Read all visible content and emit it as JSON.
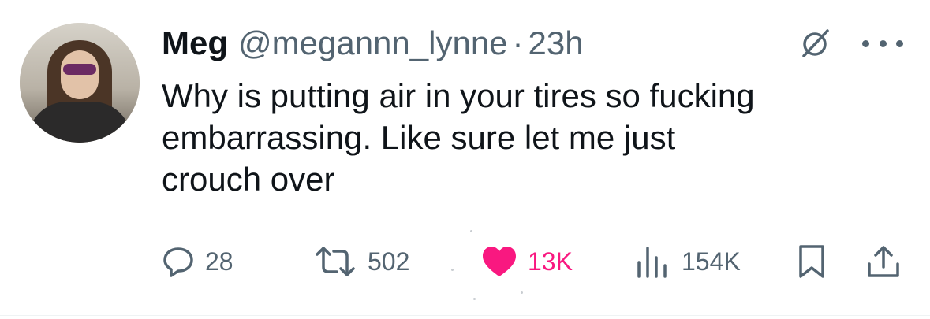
{
  "tweet": {
    "author_name": "Meg",
    "author_handle": "@megannn_lynne",
    "separator": "·",
    "timestamp": "23h",
    "text": "Why is putting air in your tires so fucking\nembarrassing. Like sure let me just\ncrouch over"
  },
  "stats": {
    "replies": "28",
    "reposts": "502",
    "likes": "13K",
    "views": "154K"
  },
  "icons": [
    "avatar",
    "grok-icon",
    "more-icon",
    "reply-icon",
    "retweet-icon",
    "heart-icon",
    "views-icon",
    "bookmark-icon",
    "share-icon"
  ],
  "colors": {
    "text_primary": "#0f1419",
    "text_secondary": "#536471",
    "like_active": "#f91880"
  }
}
